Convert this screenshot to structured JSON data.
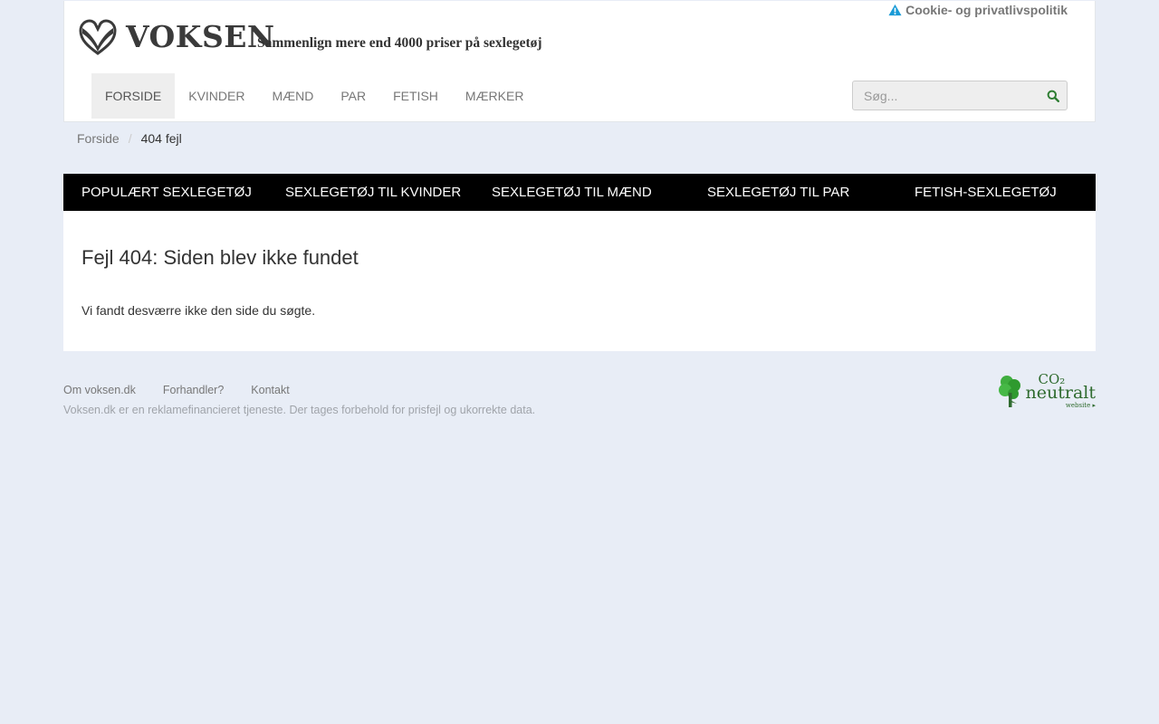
{
  "header": {
    "logo_text": "VOKSEN",
    "tagline": "Sammenlign mere end 4000 priser på sexlegetøj",
    "cookie_link": "Cookie- og privatlivspolitik"
  },
  "nav": {
    "items": [
      {
        "label": "FORSIDE",
        "active": true
      },
      {
        "label": "KVINDER"
      },
      {
        "label": "MÆND"
      },
      {
        "label": "PAR"
      },
      {
        "label": "FETISH"
      },
      {
        "label": "MÆRKER"
      }
    ]
  },
  "search": {
    "placeholder": "Søg...",
    "value": ""
  },
  "breadcrumb": {
    "home": "Forside",
    "current": "404 fejl"
  },
  "categories": [
    "POPULÆRT SEXLEGETØJ",
    "SEXLEGETØJ TIL KVINDER",
    "SEXLEGETØJ TIL MÆND",
    "SEXLEGETØJ TIL PAR",
    "FETISH-SEXLEGETØJ"
  ],
  "content": {
    "title": "Fejl 404: Siden blev ikke fundet",
    "message": "Vi fandt desværre ikke den side du søgte."
  },
  "footer": {
    "links": [
      "Om voksen.dk",
      "Forhandler?",
      "Kontakt"
    ],
    "disclaimer": "Voksen.dk er en reklamefinancieret tjeneste. Der tages forbehold for prisfejl og ukorrekte data.",
    "badge": {
      "co2": "CO₂",
      "neutralt": "neutralt",
      "website": "website ▸"
    }
  },
  "colors": {
    "page_bg": "#e8edf6",
    "catbar_bg": "#000000",
    "badge_green": "#2f6b2f",
    "search_icon": "#2e7d32"
  }
}
